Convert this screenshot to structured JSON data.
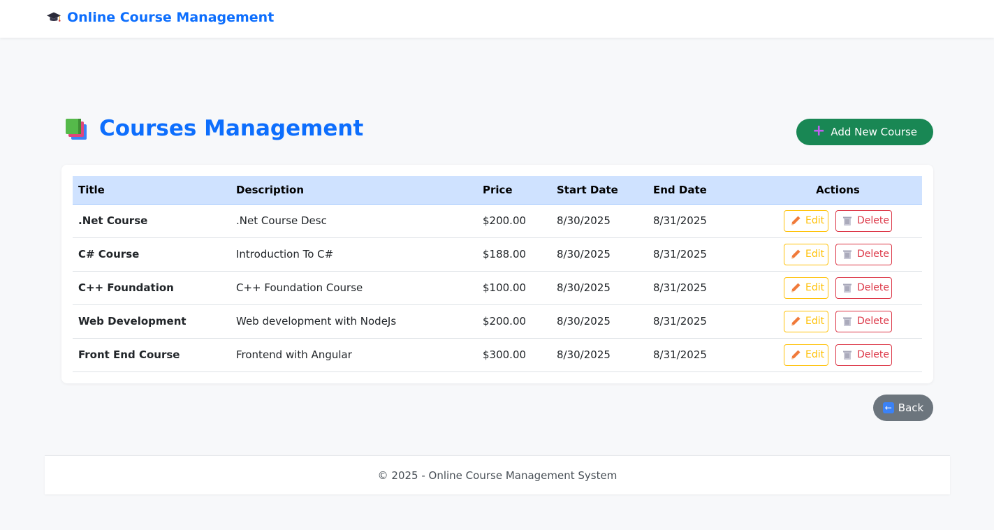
{
  "navbar": {
    "brand": "Online Course Management",
    "brand_icon": "graduation-cap-icon"
  },
  "page": {
    "title": "Courses Management",
    "title_icon": "books-icon",
    "add_button": "Add New Course",
    "back_button": "Back"
  },
  "table": {
    "headers": {
      "title": "Title",
      "description": "Description",
      "price": "Price",
      "start_date": "Start Date",
      "end_date": "End Date",
      "actions": "Actions"
    },
    "edit_label": "Edit",
    "delete_label": "Delete",
    "rows": [
      {
        "title": ".Net Course",
        "description": ".Net Course Desc",
        "price": "$200.00",
        "start_date": "8/30/2025",
        "end_date": "8/31/2025"
      },
      {
        "title": "C# Course",
        "description": "Introduction To C#",
        "price": "$188.00",
        "start_date": "8/30/2025",
        "end_date": "8/31/2025"
      },
      {
        "title": "C++ Foundation",
        "description": "C++ Foundation Course",
        "price": "$100.00",
        "start_date": "8/30/2025",
        "end_date": "8/31/2025"
      },
      {
        "title": "Web Development",
        "description": "Web development with NodeJs",
        "price": "$200.00",
        "start_date": "8/30/2025",
        "end_date": "8/31/2025"
      },
      {
        "title": "Front End Course",
        "description": "Frontend with Angular",
        "price": "$300.00",
        "start_date": "8/30/2025",
        "end_date": "8/31/2025"
      }
    ]
  },
  "footer": {
    "text": "© 2025 - Online Course Management System"
  },
  "colors": {
    "primary": "#0d6efd",
    "success": "#198754",
    "warning": "#ffc107",
    "danger": "#dc3545",
    "secondary": "#6c757d",
    "table_header_bg": "#cfe2ff"
  }
}
